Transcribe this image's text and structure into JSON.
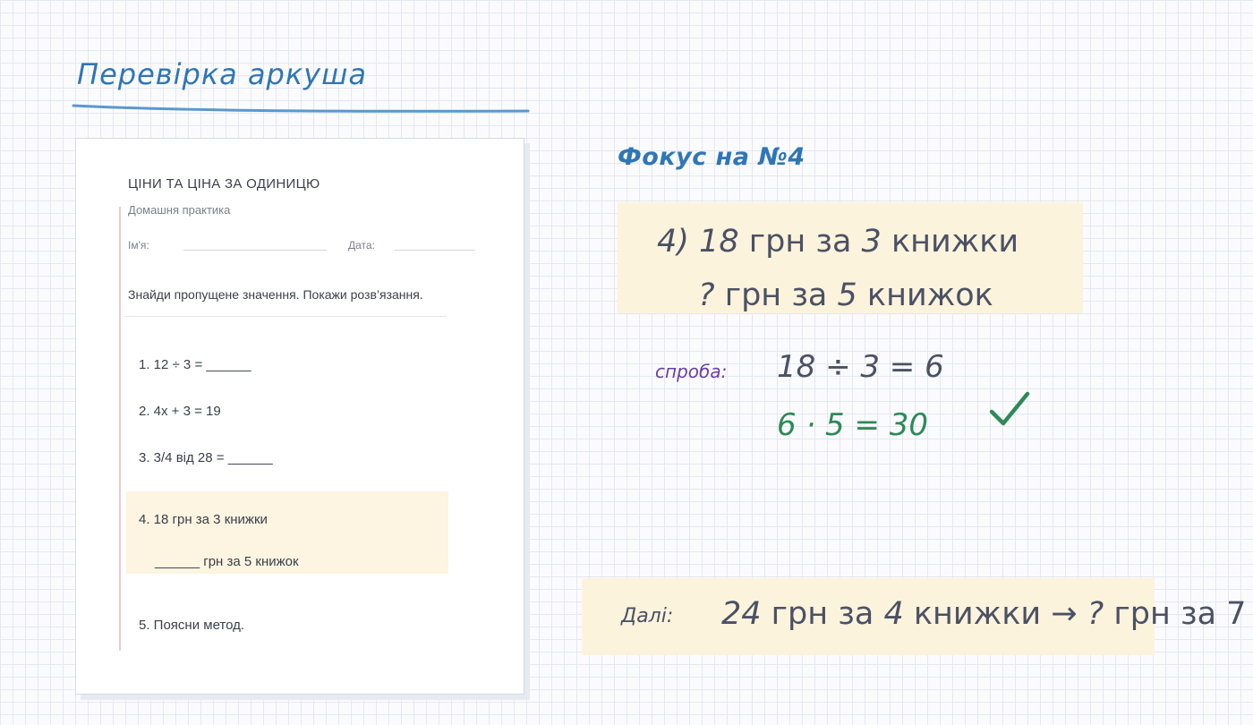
{
  "page": {
    "title": "Перевірка аркуша"
  },
  "colors": {
    "title_blue": "#2f76b5",
    "ink": "#4b5165",
    "correct_green": "#2d8a57",
    "attempt_purple": "#6b3fa4",
    "highlight": "#fcf3dc"
  },
  "worksheet": {
    "title": "ЦІНИ ТА ЦІНА ЗА ОДИНИЦЮ",
    "subtitle": "Домашня практика",
    "name_label": "Ім'я:",
    "date_label": "Дата:",
    "instructions": "Знайди пропущене значення. Покажи розв’язання.",
    "items": [
      "1.  12 ÷ 3 = ______",
      "2.  4x + 3 = 19",
      "3.  3/4 від 28 = ______",
      "4.  18 грн за 3 книжки",
      "______ грн за 5 книжок",
      "5.  Поясни метод."
    ]
  },
  "focus": {
    "heading": "Фокус на №4",
    "line1": {
      "a": "4) 18",
      "b": " грн за ",
      "c": "3",
      "d": " книжки"
    },
    "line2": {
      "a": "?",
      "b": " грн за ",
      "c": "5",
      "d": " книжок"
    },
    "attempt_label": "спроба:",
    "work1": "18 ÷ 3 = 6",
    "work2": "6 · 5 = 30",
    "check_icon": "checkmark-icon"
  },
  "next": {
    "label": "Далі:",
    "a": "24",
    "b": " грн за ",
    "c": "4",
    "d": " книжки  →  ",
    "e": "?",
    "f": " грн за 7"
  }
}
